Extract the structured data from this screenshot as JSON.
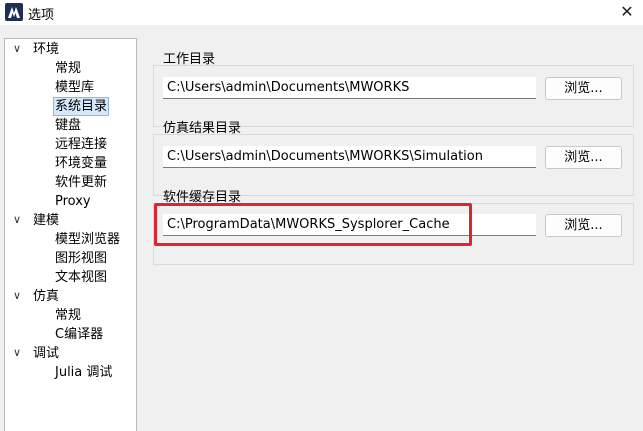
{
  "window": {
    "title": "选项",
    "close_glyph": "✕"
  },
  "tree": {
    "groups": [
      {
        "label": "环境",
        "expanded": true,
        "items": [
          "常规",
          "模型库",
          "系统目录",
          "键盘",
          "远程连接",
          "环境变量",
          "软件更新",
          "Proxy"
        ]
      },
      {
        "label": "建模",
        "expanded": true,
        "items": [
          "模型浏览器",
          "图形视图",
          "文本视图"
        ]
      },
      {
        "label": "仿真",
        "expanded": true,
        "items": [
          "常规",
          "C编译器"
        ]
      },
      {
        "label": "调试",
        "expanded": true,
        "items": [
          "Julia 调试"
        ]
      }
    ],
    "selected": "系统目录",
    "chevron_glyph": "∨"
  },
  "sections": [
    {
      "label": "工作目录",
      "path": "C:\\Users\\admin\\Documents\\MWORKS",
      "button": "浏览..."
    },
    {
      "label": "仿真结果目录",
      "path": "C:\\Users\\admin\\Documents\\MWORKS\\Simulation",
      "button": "浏览..."
    },
    {
      "label": "软件缓存目录",
      "path": "C:\\ProgramData\\MWORKS_Sysplorer_Cache",
      "button": "浏览..."
    }
  ],
  "colors": {
    "highlight": "#e0242e",
    "selection": "#d6e7fb",
    "app_icon": "#1e2f57"
  }
}
